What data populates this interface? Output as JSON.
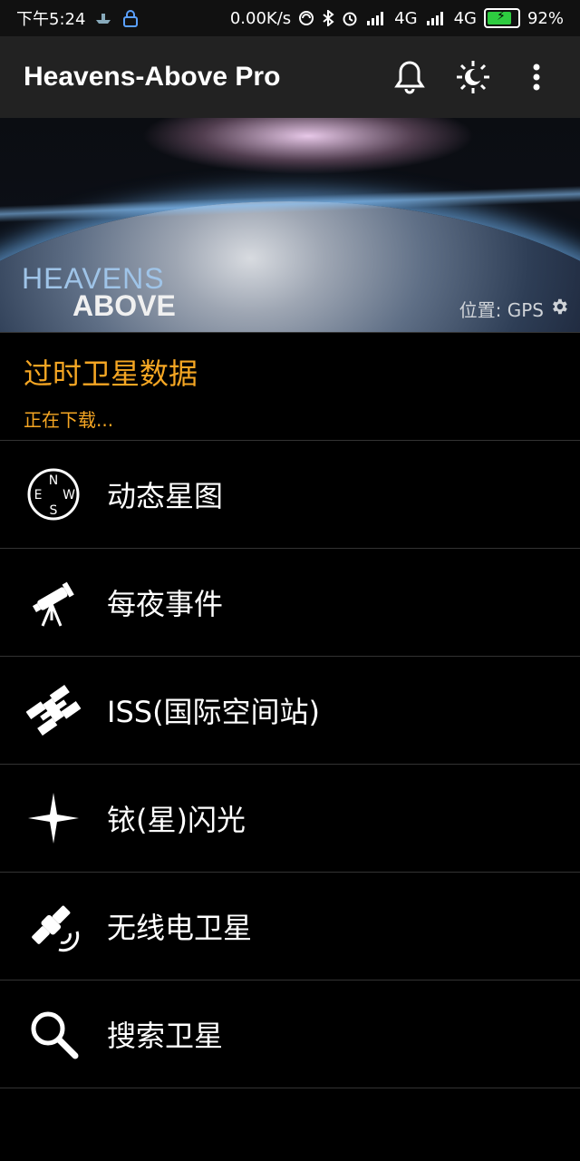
{
  "status_bar": {
    "time": "下午5:24",
    "net_speed": "0.00K/s",
    "signal1": "4G",
    "signal2": "4G",
    "battery": "92%",
    "battery_level": 0.92
  },
  "app_bar": {
    "title": "Heavens-Above Pro",
    "icons": [
      "bell-icon",
      "brightness-icon",
      "overflow-menu-icon"
    ]
  },
  "hero": {
    "logo_line1": "HEAVENS",
    "logo_line2": "ABOVE",
    "location": "位置: GPS"
  },
  "warning": {
    "title": "过时卫星数据",
    "status": "正在下载..."
  },
  "menu": [
    {
      "label": "动态星图",
      "icon": "compass-icon"
    },
    {
      "label": "每夜事件",
      "icon": "telescope-icon"
    },
    {
      "label": "ISS(国际空间站)",
      "icon": "iss-icon"
    },
    {
      "label": "铱(星)闪光",
      "icon": "flare-icon"
    },
    {
      "label": "无线电卫星",
      "icon": "radio-satellite-icon"
    },
    {
      "label": "搜索卫星",
      "icon": "search-icon"
    }
  ],
  "colors": {
    "accent": "#f5a623",
    "appbar": "#222222",
    "background": "#000000",
    "divider": "#333333"
  }
}
